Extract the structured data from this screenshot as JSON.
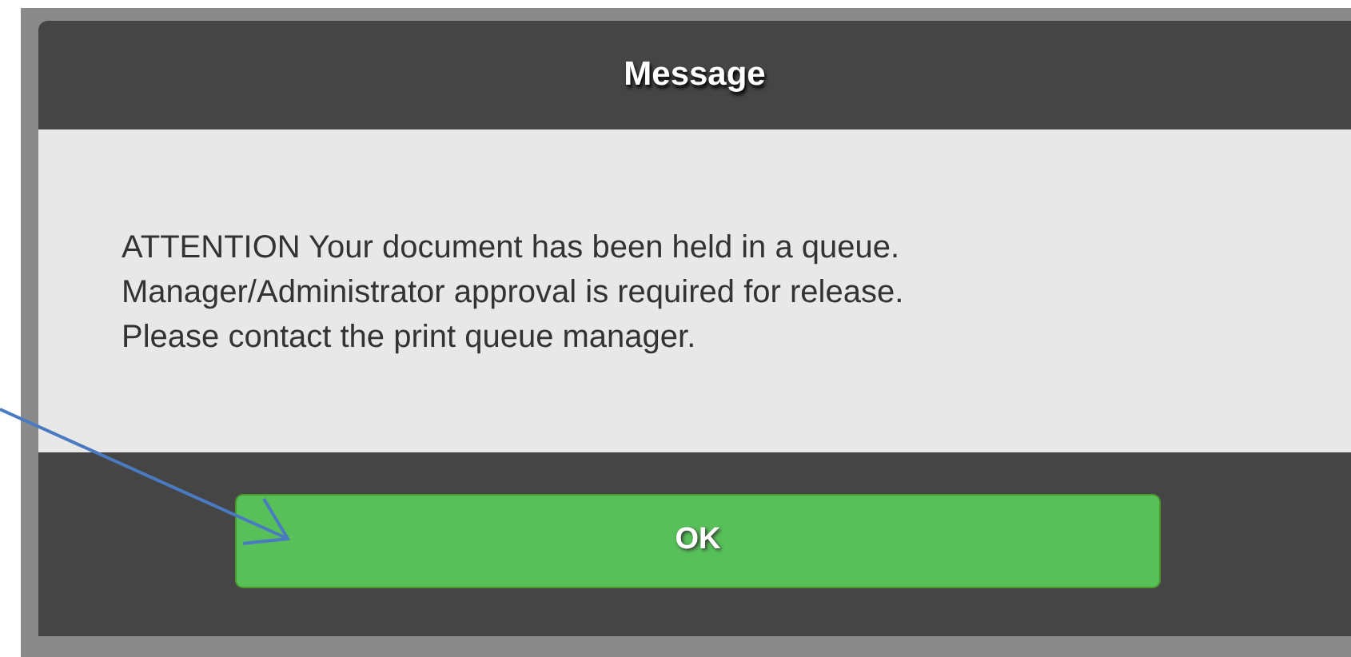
{
  "dialog": {
    "title": "Message",
    "message_lines": [
      "ATTENTION Your document has been held in a queue.",
      "Manager/Administrator approval is required for release.",
      "Please contact the print queue manager."
    ],
    "buttons": [
      {
        "label": "OK"
      }
    ]
  }
}
